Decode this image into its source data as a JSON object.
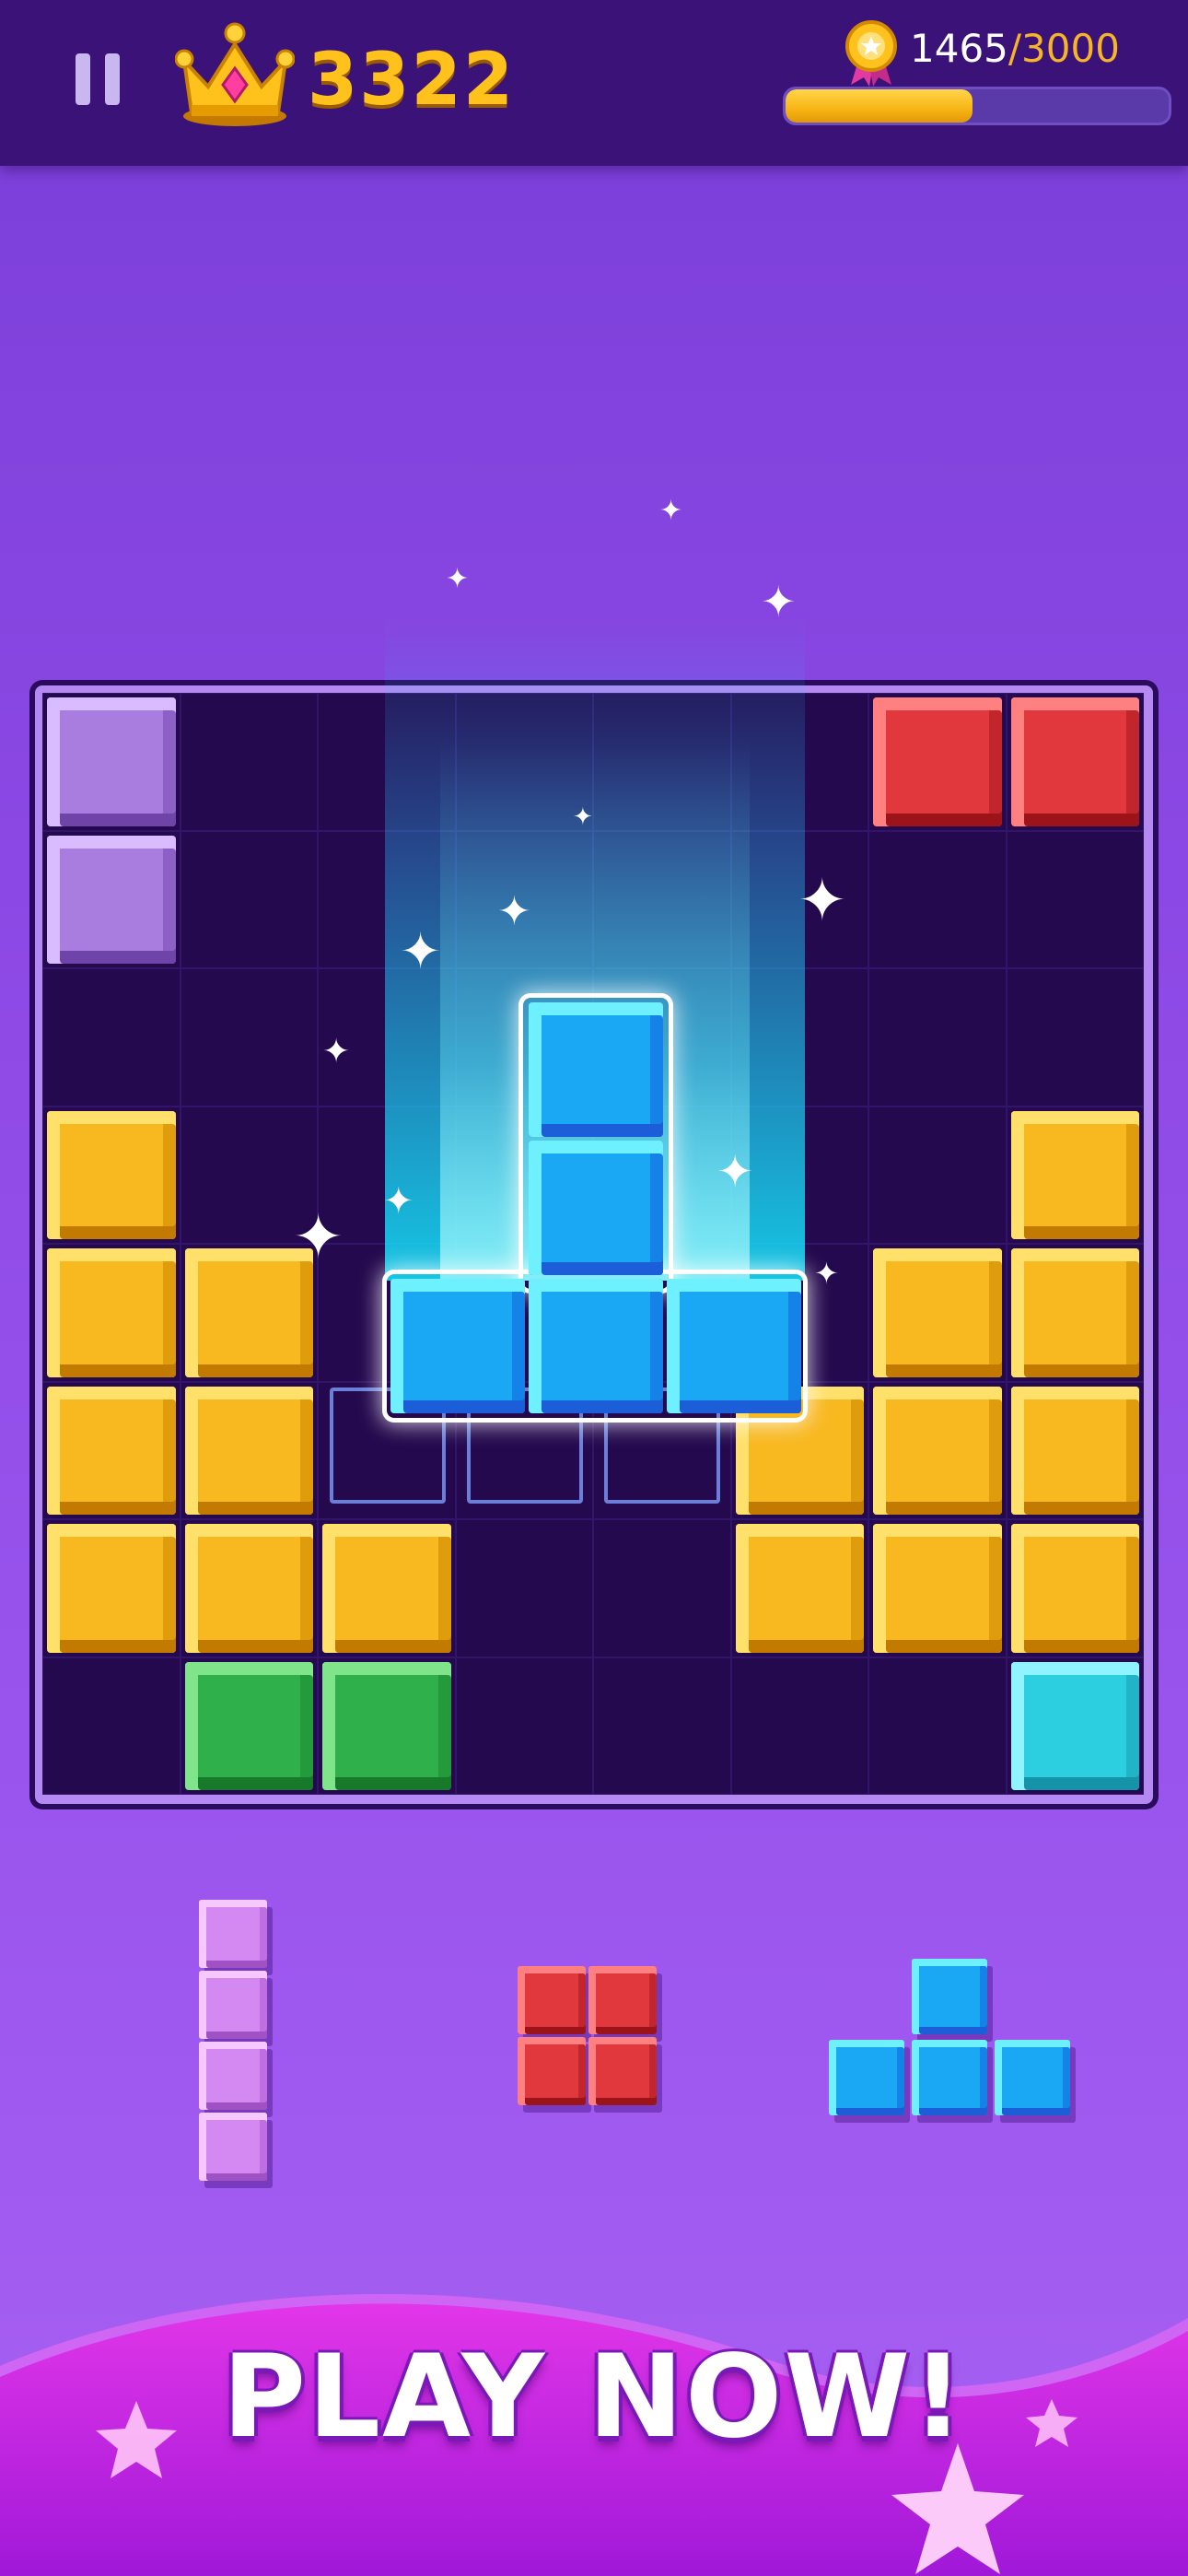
{
  "header": {
    "score": "3322",
    "goal_current": "1465",
    "goal_separator": "/",
    "goal_target": "3000",
    "progress_fraction": 0.488
  },
  "board": {
    "rows": 8,
    "cols": 8,
    "cells": [
      [
        "purple",
        "",
        "",
        "",
        "",
        "",
        "red",
        "red"
      ],
      [
        "purple",
        "",
        "",
        "",
        "",
        "",
        "",
        ""
      ],
      [
        "",
        "",
        "",
        "",
        "",
        "",
        "",
        ""
      ],
      [
        "yellow",
        "",
        "",
        "",
        "",
        "",
        "",
        "yellow"
      ],
      [
        "yellow",
        "yellow",
        "",
        "",
        "",
        "",
        "yellow",
        "yellow"
      ],
      [
        "yellow",
        "yellow",
        "",
        "",
        "",
        "yellow",
        "yellow",
        "yellow"
      ],
      [
        "yellow",
        "yellow",
        "yellow",
        "",
        "",
        "yellow",
        "yellow",
        "yellow"
      ],
      [
        "",
        "green",
        "green",
        "",
        "",
        "",
        "",
        "cyan"
      ]
    ],
    "placing_piece": {
      "color": "blue",
      "shape": "T-shape"
    }
  },
  "tray": [
    {
      "name": "vertical-line-piece",
      "color": "pink"
    },
    {
      "name": "square-piece",
      "color": "red"
    },
    {
      "name": "t-piece",
      "color": "blue"
    }
  ],
  "banner": {
    "cta": "PLAY NOW!"
  }
}
